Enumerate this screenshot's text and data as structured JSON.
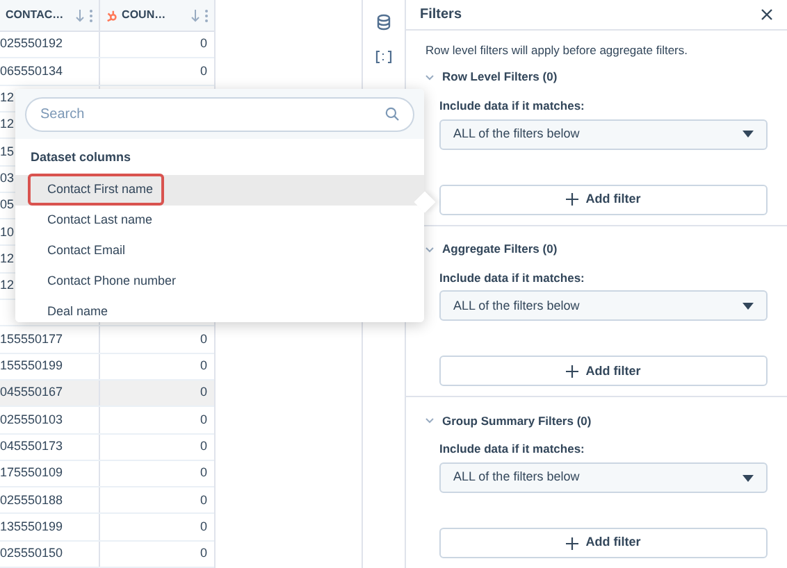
{
  "table": {
    "columns": [
      {
        "label": "CONTAC…",
        "icon": false
      },
      {
        "label": "COUN…",
        "icon": true
      }
    ],
    "rows": [
      {
        "cells": [
          "025550192",
          "0"
        ],
        "highlighted": false
      },
      {
        "cells": [
          "065550134",
          "0"
        ],
        "highlighted": false
      },
      {
        "cells": [
          "12"
        ],
        "highlighted": false
      },
      {
        "cells": [
          "12"
        ],
        "highlighted": false
      },
      {
        "cells": [
          "15"
        ],
        "highlighted": false
      },
      {
        "cells": [
          "03"
        ],
        "highlighted": false
      },
      {
        "cells": [
          "05"
        ],
        "highlighted": false
      },
      {
        "cells": [
          "10"
        ],
        "highlighted": false
      },
      {
        "cells": [
          "12"
        ],
        "highlighted": false
      },
      {
        "cells": [
          "12"
        ],
        "highlighted": false
      },
      {
        "cells": [],
        "highlighted": false
      },
      {
        "cells": [
          "155550177",
          "0"
        ],
        "highlighted": false
      },
      {
        "cells": [
          "155550199",
          "0"
        ],
        "highlighted": false
      },
      {
        "cells": [
          "045550167",
          "0"
        ],
        "highlighted": true
      },
      {
        "cells": [
          "025550103",
          "0"
        ],
        "highlighted": false
      },
      {
        "cells": [
          "045550173",
          "0"
        ],
        "highlighted": false
      },
      {
        "cells": [
          "175550109",
          "0"
        ],
        "highlighted": false
      },
      {
        "cells": [
          "025550188",
          "0"
        ],
        "highlighted": false
      },
      {
        "cells": [
          "135550199",
          "0"
        ],
        "highlighted": false
      },
      {
        "cells": [
          "025550150",
          "0"
        ],
        "highlighted": false
      }
    ]
  },
  "column_picker": {
    "search": {
      "placeholder": "Search"
    },
    "group_title": "Dataset columns",
    "items": [
      {
        "label": "Contact First name",
        "selected": true
      },
      {
        "label": "Contact Last name",
        "selected": false
      },
      {
        "label": "Contact Email",
        "selected": false
      },
      {
        "label": "Contact Phone number",
        "selected": false
      },
      {
        "label": "Deal name",
        "selected": false
      }
    ]
  },
  "filters_panel": {
    "title": "Filters",
    "note": "Row level filters will apply before aggregate filters.",
    "sections": [
      {
        "title": "Row Level Filters (0)",
        "expanded": true,
        "label": "Include data if it matches:",
        "value": "ALL of the filters below",
        "button": "Add filter"
      },
      {
        "title": "Aggregate Filters (0)",
        "expanded": true,
        "label": "Include data if it matches:",
        "value": "ALL of the filters below",
        "button": "Add filter"
      },
      {
        "title": "Group Summary Filters (0)",
        "expanded": true,
        "label": "Include data if it matches:",
        "value": "ALL of the filters below",
        "button": "Add filter"
      }
    ]
  }
}
